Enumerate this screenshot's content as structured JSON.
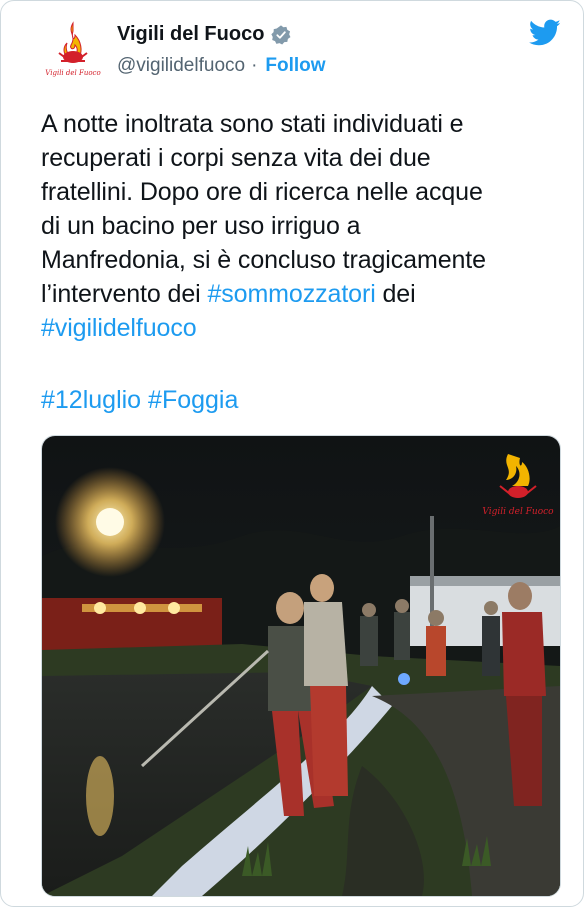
{
  "tweet": {
    "account_name": "Vigili del Fuoco",
    "handle": "@vigilidelfuoco",
    "separator": "·",
    "follow_label": "Follow",
    "text_lines": [
      "A notte inoltrata sono stati individuati e",
      "recuperati i corpi senza vita dei due",
      "fratellini. Dopo ore di ricerca nelle acque",
      "di un bacino per uso irriguo a",
      "Manfredonia, si è concluso tragicamente",
      "l’intervento dei ",
      " dei"
    ],
    "hashtag_sommozzatori": "#sommozzatori",
    "hashtag_vigilidelfuoco": "#vigilidelfuoco",
    "hashtag_12luglio": "#12luglio",
    "hashtag_foggia": "#Foggia",
    "logo_text": "Vigili del Fuoco"
  },
  "colors": {
    "link": "#1d9bf0",
    "text": "#0f1419",
    "secondary": "#536471",
    "logo_red": "#d3202a",
    "logo_gold": "#f2b400"
  },
  "icons": {
    "verified": "verified-badge-icon",
    "twitter": "twitter-bird-icon"
  }
}
